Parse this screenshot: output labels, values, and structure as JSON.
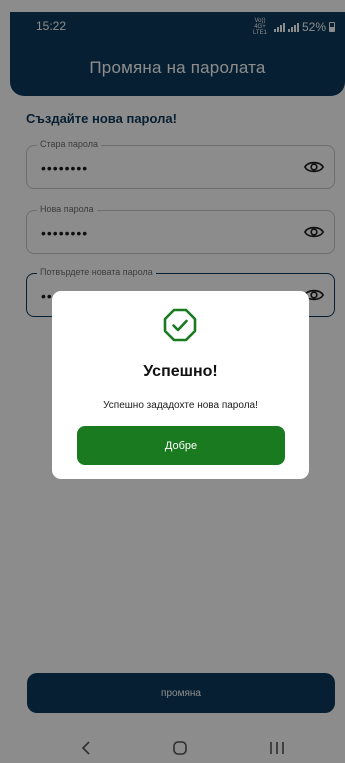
{
  "status_bar": {
    "time": "15:22",
    "network": "Vo)) 4G+ LTE1",
    "battery": "52%"
  },
  "app_bar": {
    "title": "Промяна на паролата"
  },
  "form": {
    "heading": "Създайте нова парола!",
    "fields": [
      {
        "label": "Стара парола",
        "value": "••••••••",
        "icon": "eye-icon"
      },
      {
        "label": "Нова парола",
        "value": "••••••••",
        "icon": "eye-icon"
      },
      {
        "label": "Потвърдете новата парола",
        "value": "••••••••",
        "icon": "eye-icon"
      }
    ],
    "submit_label": "промяна"
  },
  "dialog": {
    "icon": "check-octagon-icon",
    "title": "Успешно!",
    "message": "Успешно зададохте нова парола!",
    "ok_label": "Добре"
  },
  "colors": {
    "primary": "#0b3a5c",
    "success": "#1a7a1f"
  },
  "nav_bar": {
    "buttons": [
      "back-icon",
      "home-icon",
      "recent-apps-icon"
    ]
  }
}
